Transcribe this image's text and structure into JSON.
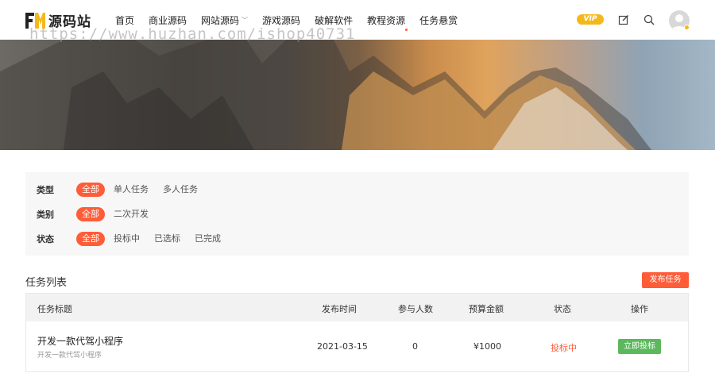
{
  "header": {
    "logo_text": "源码站",
    "nav": [
      {
        "label": "首页"
      },
      {
        "label": "商业源码"
      },
      {
        "label": "网站源码",
        "has_dropdown": true
      },
      {
        "label": "游戏源码"
      },
      {
        "label": "破解软件"
      },
      {
        "label": "教程资源"
      },
      {
        "label": "任务悬赏"
      }
    ],
    "vip_label": "VIP",
    "icons": [
      "edit-icon",
      "search-icon",
      "avatar"
    ],
    "accent_color": "#ff5c38"
  },
  "watermark": "https://www.huzhan.com/ishop40731",
  "filters": {
    "type": {
      "label": "类型",
      "options": [
        "全部",
        "单人任务",
        "多人任务"
      ],
      "selected": "全部"
    },
    "category": {
      "label": "类别",
      "options": [
        "全部",
        "二次开发"
      ],
      "selected": "全部"
    },
    "status": {
      "label": "状态",
      "options": [
        "全部",
        "投标中",
        "已选标",
        "已完成"
      ],
      "selected": "全部"
    }
  },
  "task_list": {
    "title": "任务列表",
    "publish_button": "发布任务",
    "columns": [
      "任务标题",
      "发布时间",
      "参与人数",
      "预算金额",
      "状态",
      "操作"
    ],
    "rows": [
      {
        "title": "开发一款代驾小程序",
        "subtitle": "开发一款代驾小程序",
        "date": "2021-03-15",
        "participants": "0",
        "budget": "¥1000",
        "status": "投标中",
        "action": "立即投标"
      }
    ]
  }
}
